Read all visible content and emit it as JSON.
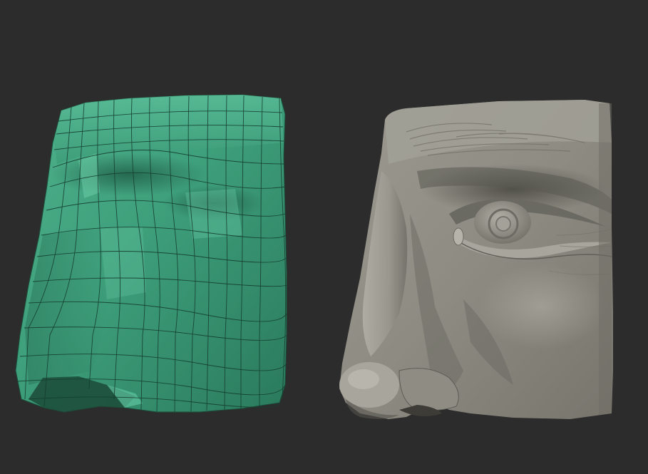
{
  "viewport": {
    "background": "#2c2c2c"
  },
  "models": [
    {
      "name": "low-poly-base-mesh",
      "material": "polygroup-green-with-wireframe",
      "color": "#3d9b78"
    },
    {
      "name": "high-res-sculpt",
      "material": "clay-gray",
      "color": "#8f8d83"
    }
  ]
}
